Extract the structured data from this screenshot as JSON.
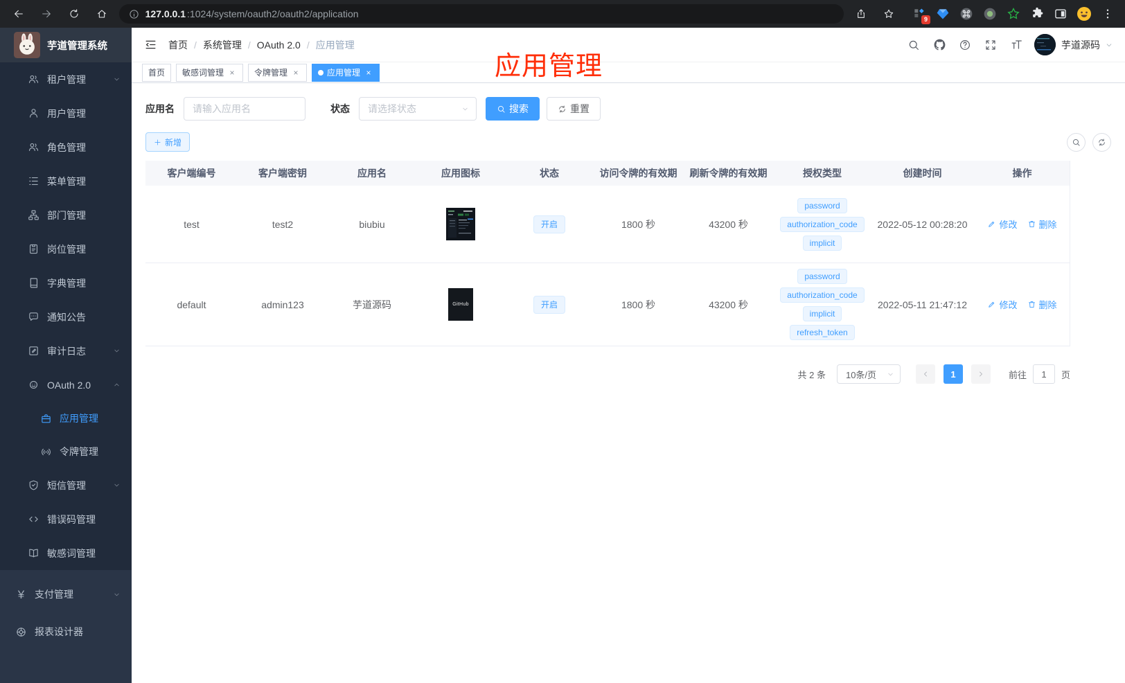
{
  "colors": {
    "accent": "#409eff",
    "tag-bg": "#ecf5ff",
    "tag-border": "#d9ecff",
    "sidebar-sub": "#212b3b",
    "sidebar-base": "#2a3547",
    "logo-bg": "#2f3845",
    "note-red": "#ff2e08"
  },
  "glyphs": {
    "close": "×",
    "yen": "¥"
  },
  "browser": {
    "url_host": "127.0.0.1",
    "url_rest": ":1024/system/oauth2/oauth2/application",
    "ext_badge": "9"
  },
  "sidebar": {
    "app_title": "芋道管理系统",
    "items": [
      {
        "label": "租户管理"
      },
      {
        "label": "用户管理"
      },
      {
        "label": "角色管理"
      },
      {
        "label": "菜单管理"
      },
      {
        "label": "部门管理"
      },
      {
        "label": "岗位管理"
      },
      {
        "label": "字典管理"
      },
      {
        "label": "通知公告"
      },
      {
        "label": "审计日志"
      },
      {
        "label": "OAuth 2.0"
      },
      {
        "label": "应用管理"
      },
      {
        "label": "令牌管理"
      },
      {
        "label": "短信管理"
      },
      {
        "label": "错误码管理"
      },
      {
        "label": "敏感词管理"
      },
      {
        "label": "支付管理"
      },
      {
        "label": "报表设计器"
      }
    ]
  },
  "header": {
    "breadcrumb": [
      "首页",
      "系统管理",
      "OAuth 2.0",
      "应用管理"
    ],
    "sep": "/",
    "username": "芋道源码"
  },
  "tabs": [
    {
      "label": "首页"
    },
    {
      "label": "敏感词管理"
    },
    {
      "label": "令牌管理"
    },
    {
      "label": "应用管理"
    }
  ],
  "annotation": "应用管理",
  "filters": {
    "name_label": "应用名",
    "name_placeholder": "请输入应用名",
    "status_label": "状态",
    "status_placeholder": "请选择状态",
    "search": "搜索",
    "reset": "重置"
  },
  "toolbar": {
    "add": "新增"
  },
  "table": {
    "columns": [
      "客户端编号",
      "客户端密钥",
      "应用名",
      "应用图标",
      "状态",
      "访问令牌的有效期",
      "刷新令牌的有效期",
      "授权类型",
      "创建时间",
      "操作"
    ],
    "actions": {
      "edit": "修改",
      "delete": "删除"
    },
    "rows": [
      {
        "client_id": "test",
        "secret": "test2",
        "name": "biubiu",
        "status": "开启",
        "access_ttl": "1800 秒",
        "refresh_ttl": "43200 秒",
        "grants": [
          "password",
          "authorization_code",
          "implicit"
        ],
        "created": "2022-05-12 00:28:20"
      },
      {
        "client_id": "default",
        "secret": "admin123",
        "name": "芋道源码",
        "icon_text": "GitHub",
        "status": "开启",
        "access_ttl": "1800 秒",
        "refresh_ttl": "43200 秒",
        "grants": [
          "password",
          "authorization_code",
          "implicit",
          "refresh_token"
        ],
        "created": "2022-05-11 21:47:12"
      }
    ]
  },
  "pagination": {
    "total": "共 2 条",
    "page_size": "10条/页",
    "current": "1",
    "goto_label": "前往",
    "goto_value": "1",
    "unit": "页"
  }
}
